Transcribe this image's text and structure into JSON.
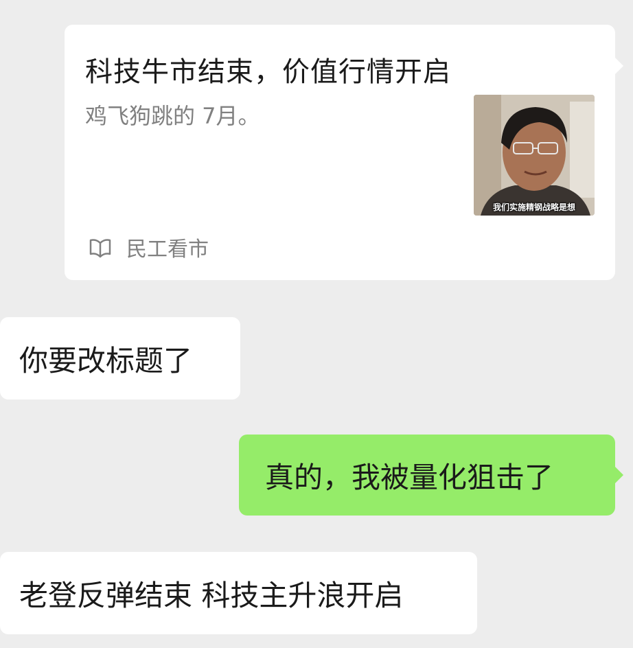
{
  "shared_card": {
    "title": "科技牛市结束，价值行情开启",
    "description": "鸡飞狗跳的 7月。",
    "thumbnail_caption": "我们实施精钢战略是想",
    "source_icon": "book-icon",
    "source_name": "民工看市"
  },
  "messages": [
    {
      "side": "left",
      "text": "你要改标题了"
    },
    {
      "side": "right",
      "text": "真的，我被量化狙击了"
    },
    {
      "side": "left",
      "text": "老登反弹结束 科技主升浪开启"
    }
  ],
  "colors": {
    "background": "#ededed",
    "incoming_bubble": "#ffffff",
    "outgoing_bubble": "#95ec69"
  }
}
